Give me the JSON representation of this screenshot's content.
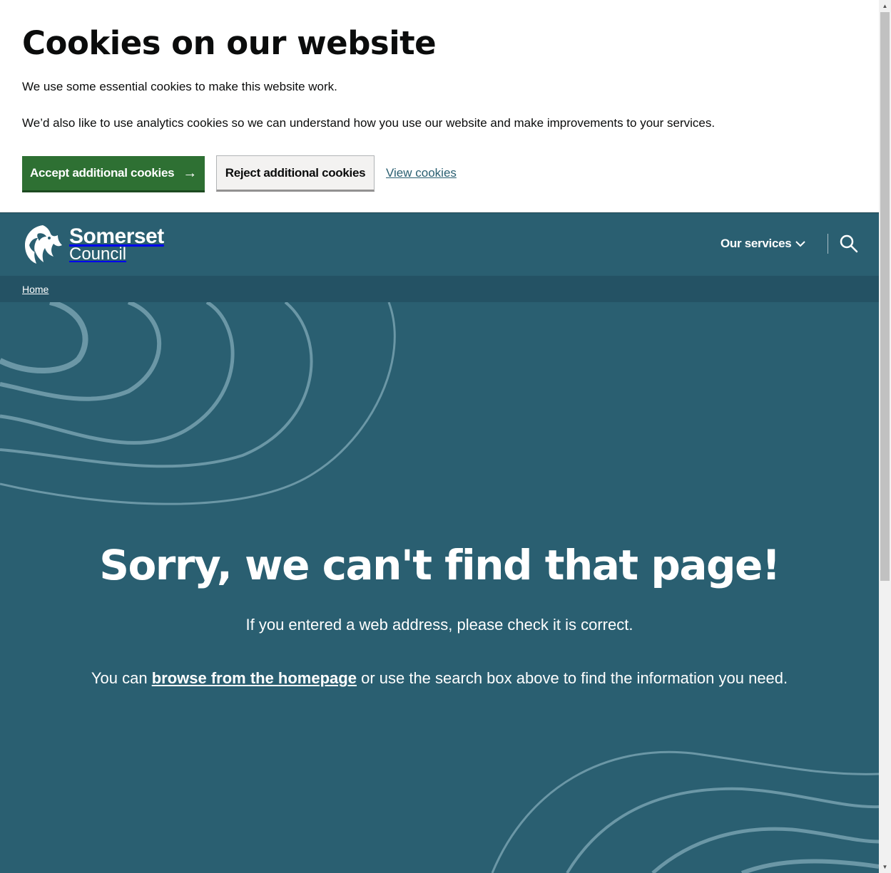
{
  "cookie_banner": {
    "title": "Cookies on our website",
    "paragraph1": "We use some essential cookies to make this website work.",
    "paragraph2": "We’d also like to use analytics cookies so we can understand how you use our website and make improvements to your services.",
    "accept_label": "Accept additional cookies",
    "accept_icon": "arrow-right-icon",
    "reject_label": "Reject additional cookies",
    "view_label": "View cookies"
  },
  "header": {
    "logo_line1": "Somerset",
    "logo_line2": "Council",
    "nav_services_label": "Our services",
    "nav_services_icon": "chevron-down-icon",
    "search_icon": "search-icon"
  },
  "breadcrumb": {
    "home_label": "Home"
  },
  "main": {
    "title": "Sorry, we can't find that page!",
    "paragraph1": "If you entered a web address, please check it is correct.",
    "paragraph2_before": "You can ",
    "paragraph2_link": "browse from the homepage",
    "paragraph2_after": " or use the search box above to find the information you need."
  },
  "colors": {
    "brand_teal": "#2a5f71",
    "breadcrumb_bg": "#245264",
    "accept_green": "#2e7033",
    "reject_grey": "#f3f2f1",
    "contour_line": "#6b97a6"
  }
}
